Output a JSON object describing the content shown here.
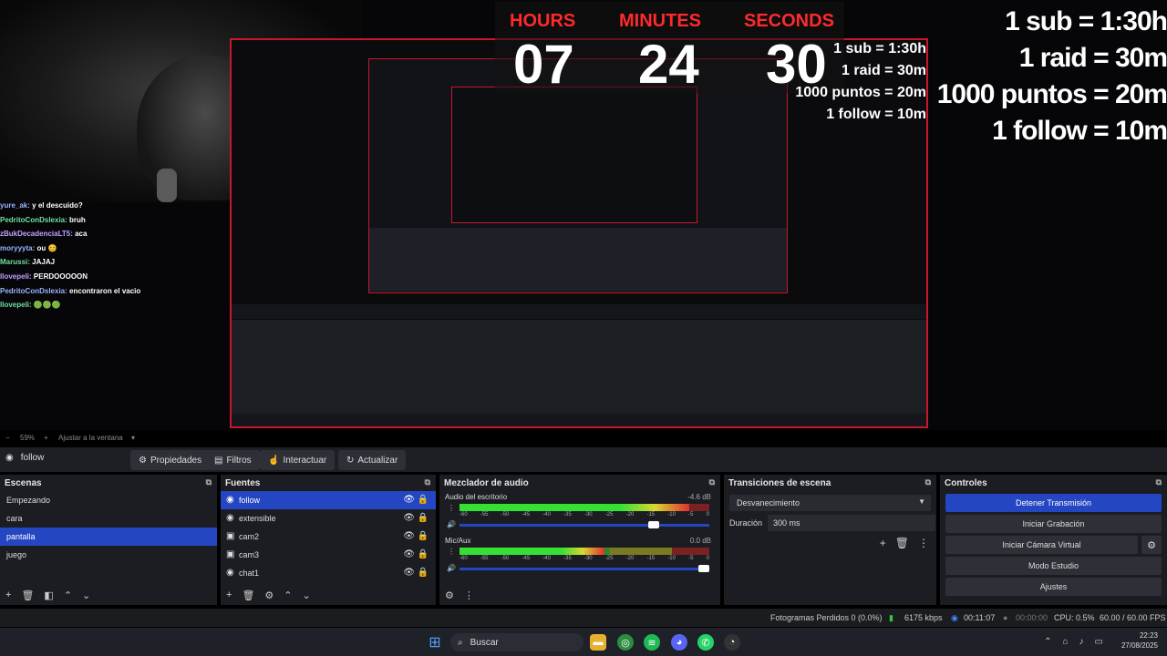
{
  "stream_overlay": {
    "timer": {
      "hours_label": "HOURS",
      "minutes_label": "MINUTES",
      "seconds_label": "SECONDS",
      "hours": "07",
      "minutes": "24",
      "seconds": "30",
      "label_color": "#ff2a2a"
    },
    "rules": [
      "1 sub = 1:30h",
      "1 raid = 30m",
      "1000 puntos = 20m",
      "1 follow = 10m"
    ],
    "chat": [
      {
        "user": "yure_ak:",
        "message": "y el descuido?"
      },
      {
        "user": "PedritoConDslexia:",
        "message": "bruh"
      },
      {
        "user": "zBukDecadenciaLT5:",
        "message": "aca"
      },
      {
        "user": "moryyyta:",
        "message": "ou 😊"
      },
      {
        "user": "Marussi:",
        "message": "JAJAJ"
      },
      {
        "user": "llovepeli:",
        "message": "PERDOOOOON"
      },
      {
        "user": "PedritoConDslexia:",
        "message": "encontraron el vacio"
      },
      {
        "user": "llovepeli:",
        "message": "🟢🟢🟢"
      }
    ]
  },
  "preview": {
    "zoom": "59%",
    "fit_label": "Ajustar a la ventana",
    "accent": "#c8162a"
  },
  "toolbar": {
    "current_scene": "follow",
    "properties": "Propiedades",
    "filters": "Filtros",
    "interact": "Interactuar",
    "refresh": "Actualizar"
  },
  "scenes": {
    "title": "Escenas",
    "items": [
      "Empezando",
      "cara",
      "pantalla",
      "juego"
    ],
    "selected": "pantalla"
  },
  "sources": {
    "title": "Fuentes",
    "items": [
      "follow",
      "extensible",
      "cam2",
      "cam3",
      "chat1"
    ],
    "selected": "follow"
  },
  "mixer": {
    "title": "Mezclador de audio",
    "channels": [
      {
        "name": "Audio del escritorio",
        "db": "-4.6 dB",
        "level": 0.92,
        "volume": 0.8
      },
      {
        "name": "Mic/Aux",
        "db": "0.0 dB",
        "level": 0.58,
        "volume": 1.0
      }
    ],
    "scale": [
      "-60",
      "-55",
      "-50",
      "-45",
      "-40",
      "-35",
      "-30",
      "-25",
      "-20",
      "-15",
      "-10",
      "-5",
      "0"
    ]
  },
  "transitions": {
    "title": "Transiciones de escena",
    "selected": "Desvanecimiento",
    "duration_label": "Duración",
    "duration_value": "300 ms"
  },
  "controls": {
    "title": "Controles",
    "stop_stream": "Detener Transmisión",
    "start_recording": "Iniciar Grabación",
    "start_virtual_cam": "Iniciar Cámara Virtual",
    "studio_mode": "Modo Estudio",
    "settings": "Ajustes",
    "primary_color": "#2546c2"
  },
  "status": {
    "dropped_frames": "Fotogramas Perdidos 0 (0.0%)",
    "bitrate": "6175 kbps",
    "stream_time": "00:11:07",
    "rec_time": "00:00:00",
    "cpu": "CPU: 0.5%",
    "fps": "60.00 / 60.00 FPS"
  },
  "taskbar": {
    "search_placeholder": "Buscar",
    "time": "22:23",
    "date": "27/08/2025"
  }
}
